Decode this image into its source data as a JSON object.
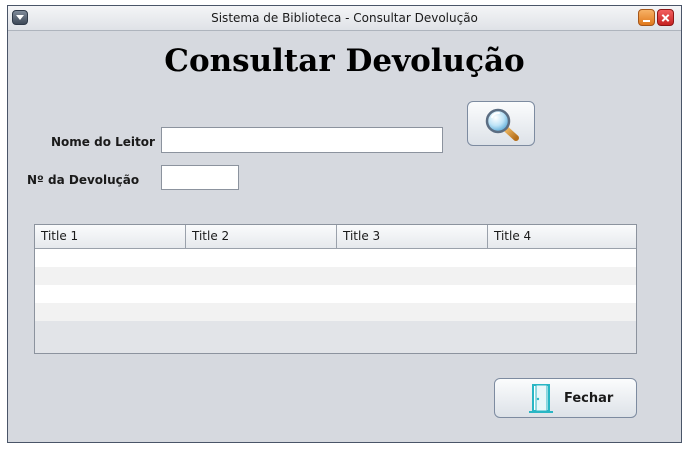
{
  "window": {
    "title": "Sistema de Biblioteca - Consultar Devolução"
  },
  "page": {
    "heading": "Consultar Devolução"
  },
  "form": {
    "reader_label": "Nome do Leitor",
    "reader_value": "",
    "return_number_label": "Nº da Devolução",
    "return_number_value": "",
    "search_button_icon": "magnifier-icon"
  },
  "table": {
    "columns": [
      "Title 1",
      "Title 2",
      "Title 3",
      "Title 4"
    ],
    "rows": 5
  },
  "actions": {
    "close_label": "Fechar",
    "close_icon": "door-icon"
  },
  "colors": {
    "window_bg": "#d6d9df",
    "minimize_button": "#e0781c",
    "close_button": "#c62222",
    "door_icon": "#29b6c4"
  }
}
